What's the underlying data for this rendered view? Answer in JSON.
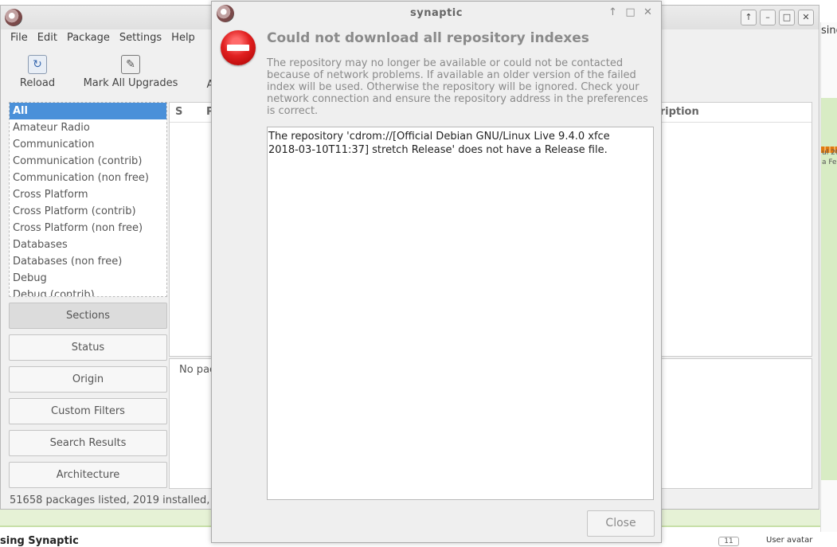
{
  "background": {
    "right_text": "sing",
    "right_small_1": "ul 20",
    "right_small_2": "a Fe",
    "bottom_heading": "sing Synaptic",
    "badge": "11",
    "avatar_label": "User avatar"
  },
  "main_window": {
    "menu": [
      "File",
      "Edit",
      "Package",
      "Settings",
      "Help"
    ],
    "toolbar": {
      "reload_label": "Reload",
      "mark_all_label": "Mark All Upgrades",
      "apply_partial": "A"
    },
    "sections": [
      "All",
      "Amateur Radio",
      "Communication",
      "Communication (contrib)",
      "Communication (non free)",
      "Cross Platform",
      "Cross Platform (contrib)",
      "Cross Platform (non free)",
      "Databases",
      "Databases (non free)",
      "Debug",
      "Debug (contrib)"
    ],
    "filter_buttons": [
      "Sections",
      "Status",
      "Origin",
      "Custom Filters",
      "Search Results",
      "Architecture"
    ],
    "table_headers": {
      "s": "S",
      "p": "P",
      "description": "cription"
    },
    "desc_placeholder": "No pac",
    "status_text": "51658 packages listed, 2019 installed, 0"
  },
  "dialog": {
    "title": "synaptic",
    "heading": "Could not download all repository indexes",
    "message": "The repository may no longer be available or could not be contacted because of network problems. If available an older version of the failed index will be used. Otherwise the repository will be ignored. Check your network connection and ensure the repository address in the preferences is correct.",
    "details_line1": "The repository 'cdrom://[Official Debian GNU/Linux Live 9.4.0 xfce",
    "details_line2": "2018-03-10T11:37] stretch Release' does not have a Release file.",
    "close_label": "Close"
  }
}
